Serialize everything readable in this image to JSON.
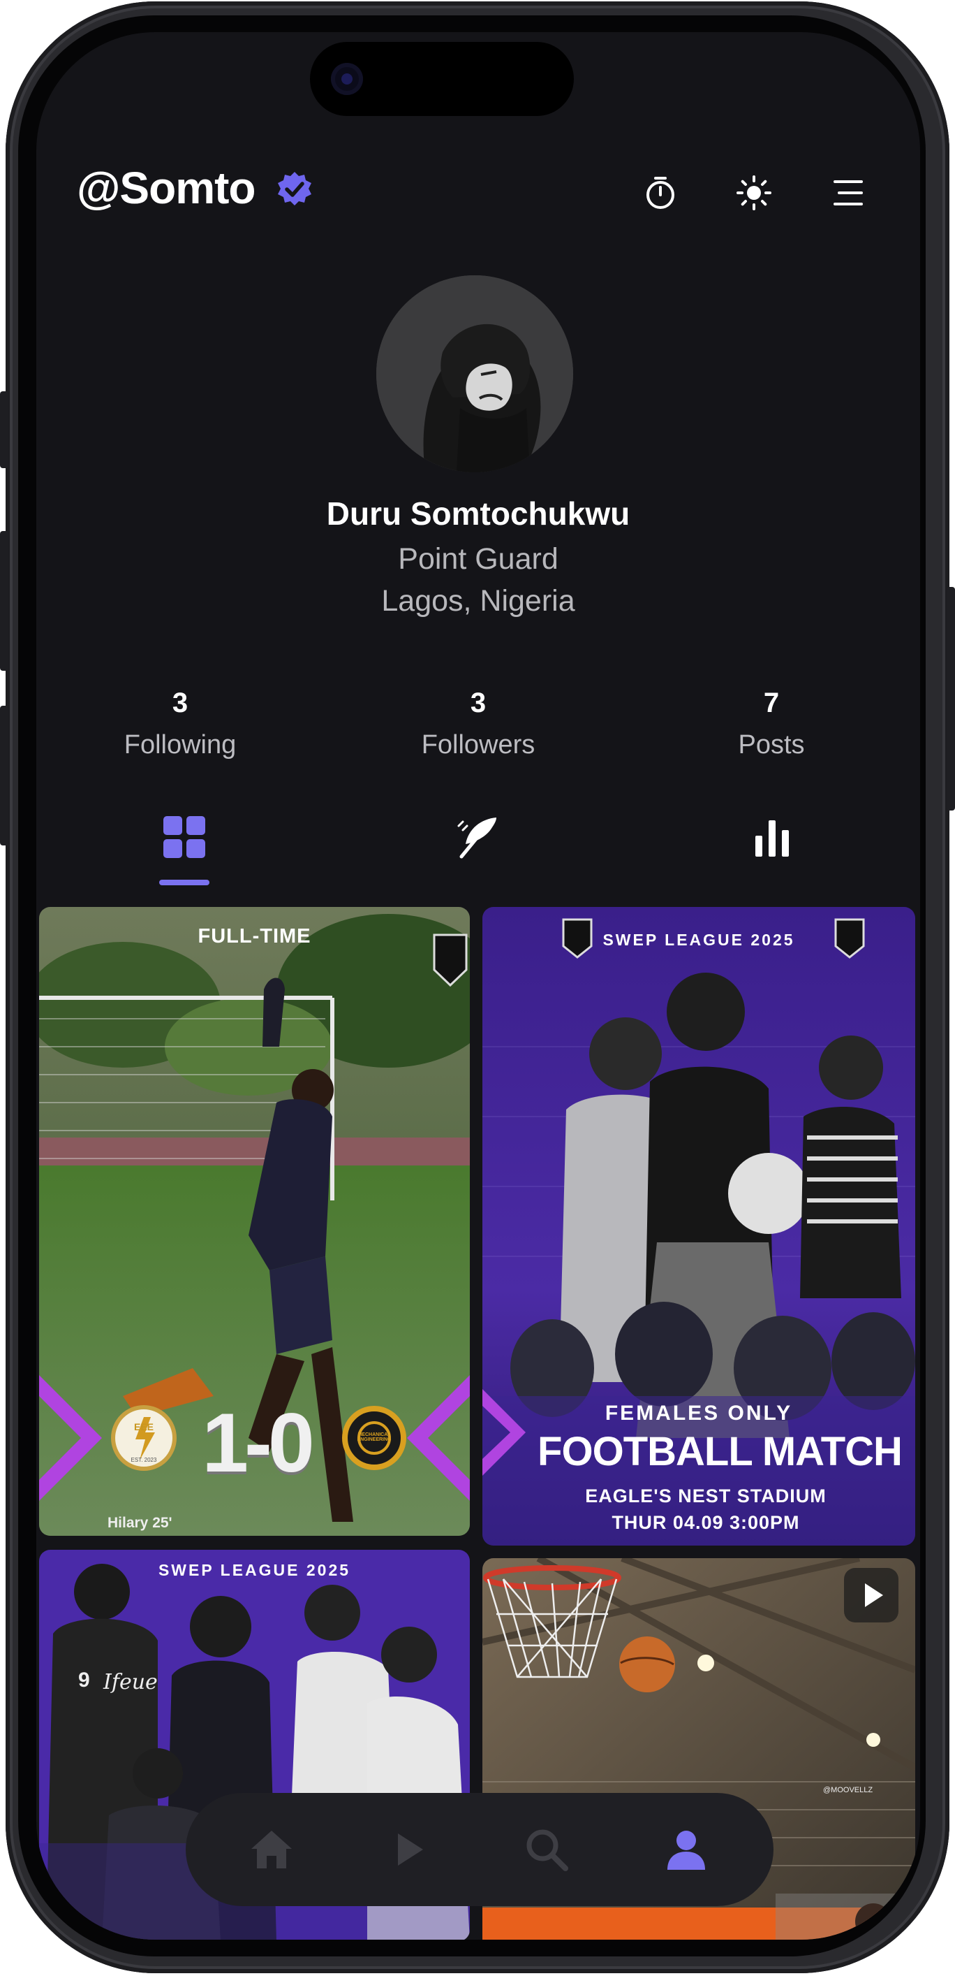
{
  "profile": {
    "handle": "@Somto",
    "full_name": "Duru Somtochukwu",
    "position": "Point Guard",
    "location": "Lagos, Nigeria"
  },
  "header_icons": [
    "verified-badge-icon",
    "stopwatch-icon",
    "sun-icon",
    "menu-icon"
  ],
  "stats": [
    {
      "value": "3",
      "label": "Following"
    },
    {
      "value": "3",
      "label": "Followers"
    },
    {
      "value": "7",
      "label": "Posts"
    }
  ],
  "tabs": [
    {
      "icon": "grid-icon",
      "active": true
    },
    {
      "icon": "feather-icon",
      "active": false
    },
    {
      "icon": "bar-chart-icon",
      "active": false
    }
  ],
  "posts": {
    "post1": {
      "badge": "FULL-TIME",
      "score": "1-0",
      "scorer": "Hilary 25'",
      "home_logo_text": "EEE",
      "home_logo_sub": "EST. 2023",
      "away_logo_text": "MECHANICAL ENGINEERING"
    },
    "post2": {
      "league": "SWEP LEAGUE 2025",
      "tagline": "FEMALES ONLY",
      "title": "FOOTBALL MATCH",
      "venue": "EAGLE'S NEST STADIUM",
      "datetime": "THUR 04.09 3:00PM"
    },
    "post3": {
      "league": "SWEP LEAGUE 2025",
      "jersey_text": "Ifeue",
      "jersey_number": "9"
    },
    "post4": {
      "type": "video",
      "watermark": "@MOOVELLZ"
    }
  },
  "bottom_nav": [
    {
      "icon": "home-icon",
      "active": false
    },
    {
      "icon": "play-icon",
      "active": false
    },
    {
      "icon": "search-icon",
      "active": false
    },
    {
      "icon": "profile-icon",
      "active": true
    }
  ],
  "colors": {
    "background": "#141418",
    "accent": "#7b72f0",
    "text_primary": "#ffffff",
    "text_secondary": "#b8b8bc",
    "nav_background": "#1f1f24",
    "poster_purple": "#4a2aa8"
  }
}
